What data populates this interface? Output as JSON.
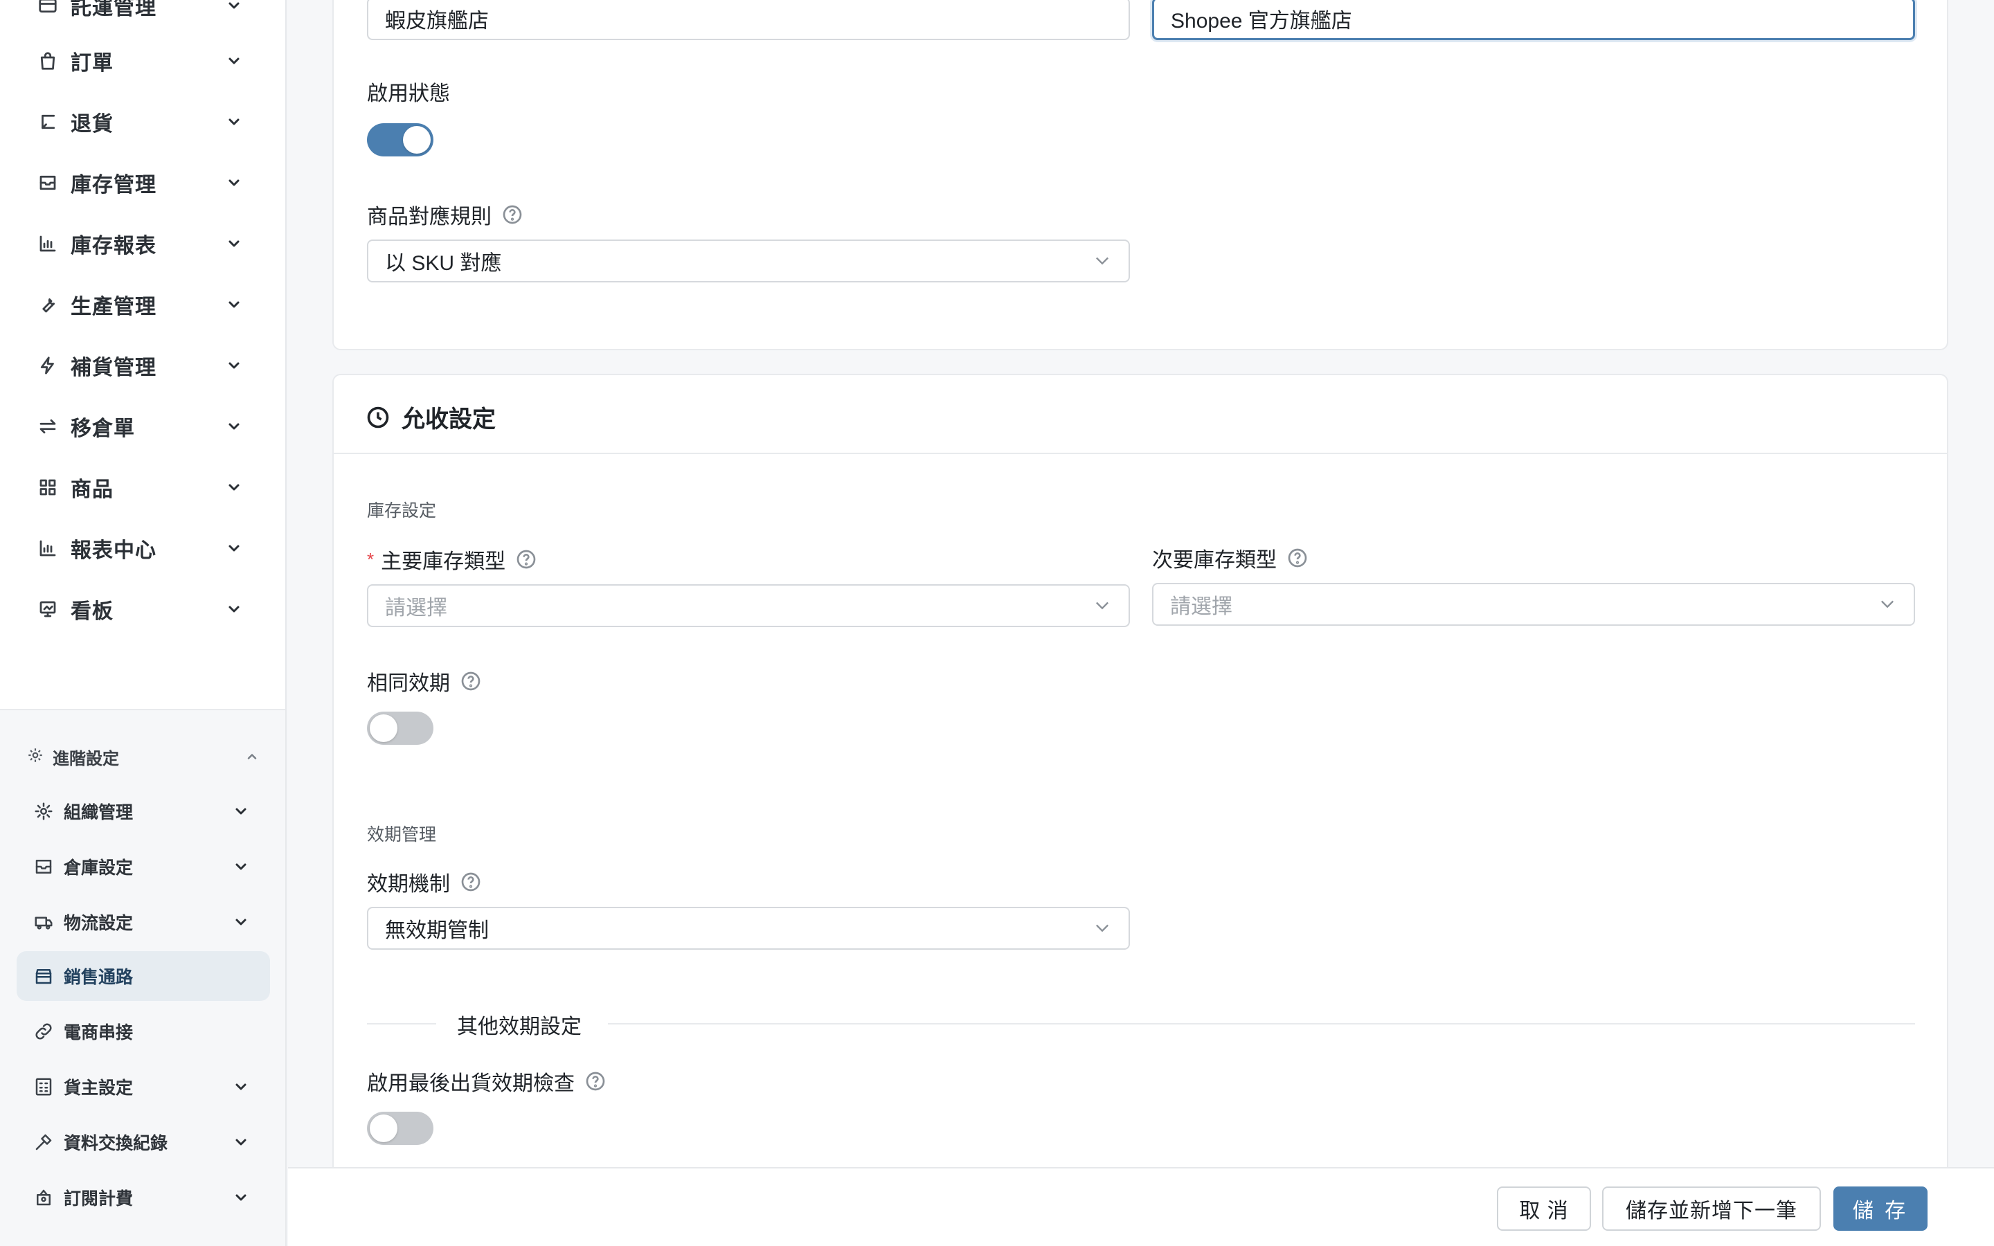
{
  "sidebar": {
    "top_items": [
      {
        "label": "託運管理",
        "icon": "shipment-icon"
      },
      {
        "label": "訂單",
        "icon": "shopping-bag-icon"
      },
      {
        "label": "退貨",
        "icon": "return-icon"
      },
      {
        "label": "庫存管理",
        "icon": "inbox-icon"
      },
      {
        "label": "庫存報表",
        "icon": "bar-chart-icon"
      },
      {
        "label": "生產管理",
        "icon": "wrench-icon"
      },
      {
        "label": "補貨管理",
        "icon": "lightning-icon"
      },
      {
        "label": "移倉單",
        "icon": "swap-icon"
      },
      {
        "label": "商品",
        "icon": "grid-icon"
      },
      {
        "label": "報表中心",
        "icon": "bar-chart-icon"
      },
      {
        "label": "看板",
        "icon": "dashboard-icon"
      }
    ],
    "advanced": {
      "title": "進階設定",
      "items": [
        {
          "label": "組織管理",
          "icon": "gear-icon",
          "has_chevron": true
        },
        {
          "label": "倉庫設定",
          "icon": "inbox-icon",
          "has_chevron": true
        },
        {
          "label": "物流設定",
          "icon": "truck-icon",
          "has_chevron": true
        },
        {
          "label": "銷售通路",
          "icon": "store-icon",
          "has_chevron": false,
          "active": true
        },
        {
          "label": "電商串接",
          "icon": "link-icon",
          "has_chevron": false
        },
        {
          "label": "貨主設定",
          "icon": "calculator-icon",
          "has_chevron": true
        },
        {
          "label": "資料交換紀錄",
          "icon": "plug-icon",
          "has_chevron": true
        },
        {
          "label": "訂閱計費",
          "icon": "subscription-icon",
          "has_chevron": true
        }
      ]
    }
  },
  "form_top": {
    "name_value": "蝦皮旗艦店",
    "display_name_value": "Shopee 官方旗艦店",
    "enable_label": "啟用狀態",
    "enable_on": true,
    "mapping_label": "商品對應規則",
    "mapping_value": "以 SKU 對應"
  },
  "receiving": {
    "title": "允收設定",
    "stock_group": "庫存設定",
    "primary_stock_label": "主要庫存類型",
    "primary_required_mark": "*",
    "primary_placeholder": "請選擇",
    "secondary_stock_label": "次要庫存類型",
    "secondary_placeholder": "請選擇",
    "same_expiry_label": "相同效期",
    "same_expiry_on": false,
    "expiry_group": "效期管理",
    "expiry_mech_label": "效期機制",
    "expiry_mech_value": "無效期管制",
    "other_expiry_divider": "其他效期設定",
    "last_ship_check_label": "啟用最後出貨效期檢查",
    "last_ship_check_on": false
  },
  "footer": {
    "cancel_label": "取 消",
    "save_next_label": "儲存並新增下一筆",
    "save_label": "儲 存"
  },
  "colors": {
    "accent": "#4b7fb0",
    "active_nav_bg": "#e6ecf1",
    "required": "#e5484d"
  }
}
